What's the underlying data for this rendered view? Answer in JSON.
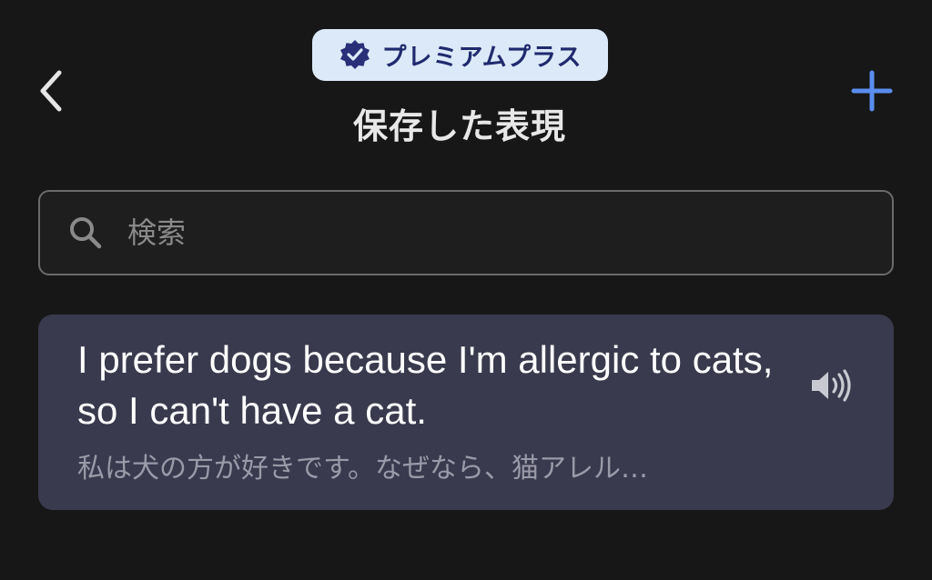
{
  "header": {
    "badge_label": "プレミアムプラス",
    "title": "保存した表現",
    "back_icon": "chevron-left-icon",
    "add_icon": "plus-icon",
    "badge_icon": "verified-badge-icon"
  },
  "search": {
    "placeholder": "検索",
    "value": "",
    "icon": "search-icon"
  },
  "phrases": [
    {
      "english": "I prefer dogs because I'm allergic to cats, so I can't have a cat.",
      "japanese": "私は犬の方が好きです。なぜなら、猫アレル…",
      "audio_icon": "speaker-icon"
    }
  ],
  "colors": {
    "background": "#171717",
    "accent": "#5b8def",
    "badge_bg": "#dce9f8",
    "badge_text": "#1f2a6e",
    "card_bg": "#3a3a4e"
  }
}
